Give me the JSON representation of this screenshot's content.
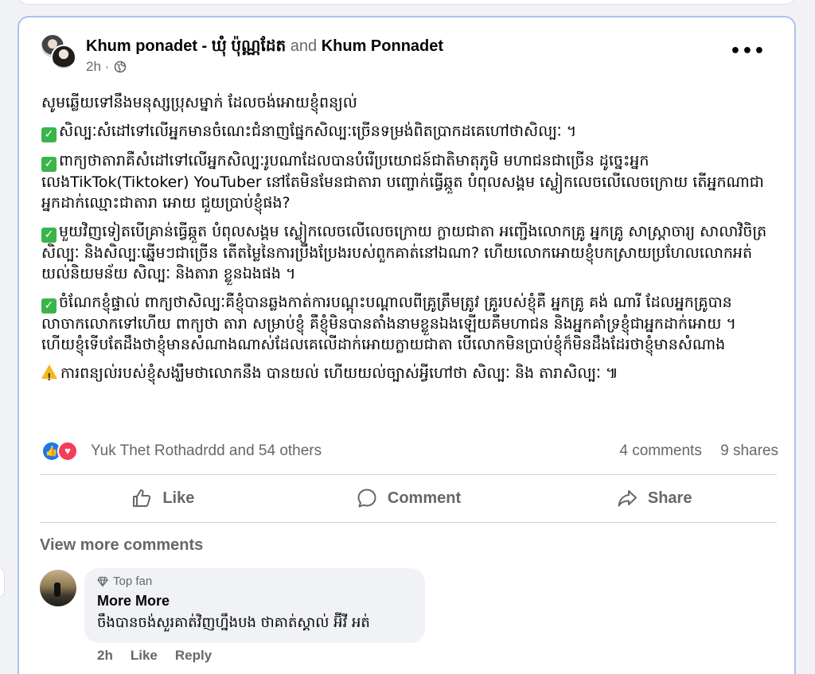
{
  "post": {
    "author1": "Khum ponadet - ឃុំ ប៉ុណ្ណដែត",
    "connector": "and",
    "author2": "Khum Ponnadet",
    "time": "2h ·",
    "more_label": "•••",
    "paragraphs": [
      {
        "icon": "none",
        "text": "សូមឆ្លើយទៅនឹងមនុស្សប្រុសម្នាក់ ដែលចង់អោយខ្ញុំពន្យល់"
      },
      {
        "icon": "check",
        "text": "សិល្បៈសំដៅទៅលើអ្នកមានចំណេះជំនាញផ្នែកសិល្បៈច្រើនទម្រង់ពិតប្រាកដគេហៅថាសិល្បៈ ។"
      },
      {
        "icon": "check",
        "text": "ពាក្យថាតារាគឺសំដៅទៅលើអ្នកសិល្បៈរូបណាដែលបានបំរើប្រយោជន៍ជាតិមាតុភូមិ មហាជនជាច្រើន ដូច្នេះអ្នកលេងTikTok(Tiktoker) YouTuber នៅតែមិនមែនជាតារា បញ្ចោក់ធ្វើឆ្កួត បំពុលសង្គម ស្លៀកលេចលើលេចក្រោយ តើអ្នកណាជាអ្នកដាក់ឈ្មោះជាតារា អោយ ជួយប្រាប់ខ្ញុំផង?"
      },
      {
        "icon": "check",
        "text": "មួយវិញទៀតបើគ្រាន់ធ្វើឆ្កួត បំពុលសង្គម ស្លៀកលេចលើលេចក្រោយ ក្លាយជាតា អញ្ជើងលោកគ្រូ អ្នកគ្រូ សាស្ត្រាចារ្យ សាលាវិចិត្រសិល្បៈ និងសិល្បៈឆ្នើមៗជាច្រើន តើតម្លៃនៃការប្រឹងប្រែងរបស់ពួកគាត់នៅឯណា? ហើយលោកអោយខ្ញុំបកស្រាយប្រហែលលោកអត់យល់និយមន័យ សិល្បៈ និងតារា ខ្លួនឯងផង ។"
      },
      {
        "icon": "check",
        "text": "ចំណែកខ្ញុំផ្ទាល់ ពាក្យថាសិល្បៈគឺខ្ញុំបានឆ្លងកាត់ការបណ្តុះបណ្តាលពីគ្រូត្រឹមត្រូវ គ្រូរបស់ខ្ញុំគឺ អ្នកគ្រូ គង់ ណារី ដែលអ្នកគ្រូបានលាចាកលោកទៅហើយ ពាក្យថា តារា សម្រាប់ខ្ញុំ គឺខ្ញុំមិនបានតាំងនាមខ្លួនឯងឡើយគឺមហាជន និងអ្នកគាំទ្រខ្ញុំជាអ្នកដាក់អោយ ។ ហើយខ្ញុំទើបតែដឹងថាខ្ញុំមានសំណាងណាស់ដែលគេលើដាក់អោយក្លាយជាតា បើលោកមិនប្រាប់ខ្ញុំក៏មិនដឹងដែរថាខ្ញុំមានសំណាង"
      },
      {
        "icon": "warn",
        "text": "ការពន្យល់របស់ខ្ញុំសង្ឃឹមថាលោកនឹង បានយល់ ហើយយល់ច្បាស់អ្វីហៅថា សិល្បៈ និង តារាសិល្បៈ ៕"
      }
    ]
  },
  "reactions": {
    "names": "Yuk Thet Rothadrdd and 54 others",
    "comments": "4 comments",
    "shares": "9 shares"
  },
  "actions": {
    "like": "Like",
    "comment": "Comment",
    "share": "Share"
  },
  "comments": {
    "view_more": "View more comments",
    "badge": "Top fan",
    "author": "More More",
    "text": "ចឹងបានចង់សួរគាត់វិញហ្នឹងបង ថាគាត់ស្គាល់ អ៊ីវី អត់",
    "time": "2h",
    "like": "Like",
    "reply": "Reply"
  },
  "colors": {
    "accent": "#1877f2",
    "love": "#f33e58",
    "check": "#3bb54a",
    "warning": "#f5b81a",
    "card_border": "#a9c4ee"
  }
}
